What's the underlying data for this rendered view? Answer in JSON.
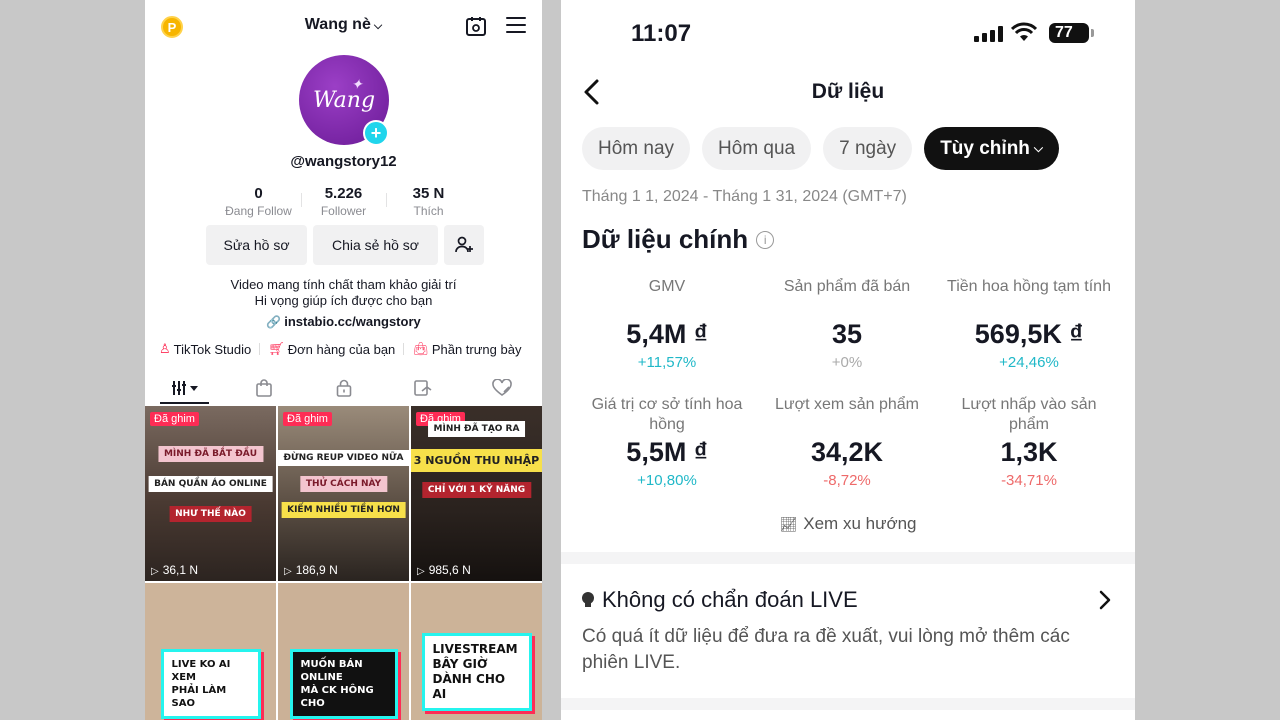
{
  "profile": {
    "coin_label": "P",
    "display_name": "Wang nè",
    "avatar_text": "Wang",
    "handle": "@wangstory12",
    "stats": [
      {
        "value": "0",
        "label": "Đang Follow"
      },
      {
        "value": "5.226",
        "label": "Follower"
      },
      {
        "value": "35 N",
        "label": "Thích"
      }
    ],
    "buttons": {
      "edit": "Sửa hồ sơ",
      "share": "Chia sẻ hồ sơ"
    },
    "bio_line1": "Video mang tính chất tham khảo giải trí",
    "bio_line2": "Hi vọng giúp ích được cho bạn",
    "link": "instabio.cc/wangstory",
    "shortcuts": [
      "TikTok Studio",
      "Đơn hàng của bạn",
      "Phần trưng bày"
    ],
    "tab_icons": [
      "videos-grid-icon",
      "shop-bag-icon",
      "private-lock-icon",
      "reposts-icon",
      "liked-icon"
    ],
    "videos": [
      {
        "pinned": "Đã ghim",
        "views": "36,1 N",
        "captions": [
          "MÌNH ĐÃ BẮT ĐẦU",
          "BÁN QUẦN ÁO ONLINE",
          "NHƯ THẾ NÀO"
        ]
      },
      {
        "pinned": "Đã ghim",
        "views": "186,9 N",
        "captions": [
          "ĐỪNG REUP VIDEO NỮA",
          "THỬ CÁCH NÀY",
          "KIẾM NHIỀU TIỀN HƠN"
        ]
      },
      {
        "pinned": "Đã ghim",
        "views": "985,6 N",
        "captions": [
          "MÌNH ĐÃ TẠO RA",
          "3 NGUỒN THU NHẬP",
          "CHỈ VỚI 1 KỸ NĂNG"
        ]
      },
      {
        "captions": [
          "LIVE KO AI XEM",
          "PHẢI LÀM SAO"
        ]
      },
      {
        "captions": [
          "MUỐN BÁN ONLINE",
          "MÀ CK HÔNG CHO"
        ]
      },
      {
        "captions": [
          "LIVESTREAM",
          "BÂY GIỜ",
          "DÀNH CHO AI"
        ]
      }
    ]
  },
  "status": {
    "time": "11:07",
    "battery": "77"
  },
  "data_page": {
    "title": "Dữ liệu",
    "chips": [
      "Hôm nay",
      "Hôm qua",
      "7 ngày",
      "Tùy chỉnh"
    ],
    "date_range": "Tháng 1 1, 2024 - Tháng 1 31, 2024 (GMT+7)",
    "section_title": "Dữ liệu chính",
    "info_icon": "i",
    "metrics": [
      {
        "label": "GMV",
        "value": "5,4M ₫",
        "change": "+11,57%",
        "trend": "pos"
      },
      {
        "label": "Sản phẩm đã bán",
        "value": "35",
        "change": "+0%",
        "trend": "neu"
      },
      {
        "label": "Tiền hoa hồng tạm tính",
        "value": "569,5K ₫",
        "change": "+24,46%",
        "trend": "pos"
      },
      {
        "label": "Giá trị cơ sở tính hoa hồng",
        "value": "5,5M ₫",
        "change": "+10,80%",
        "trend": "pos"
      },
      {
        "label": "Lượt xem sản phẩm",
        "value": "34,2K",
        "change": "-8,72%",
        "trend": "neg"
      },
      {
        "label": "Lượt nhấp vào sản phẩm",
        "value": "1,3K",
        "change": "-34,71%",
        "trend": "neg"
      }
    ],
    "trend_link": "Xem xu hướng",
    "diagnosis_title": "Không có chẩn đoán LIVE",
    "diagnosis_body": "Có quá ít dữ liệu để đưa ra đề xuất, vui lòng mở thêm các phiên LIVE."
  }
}
